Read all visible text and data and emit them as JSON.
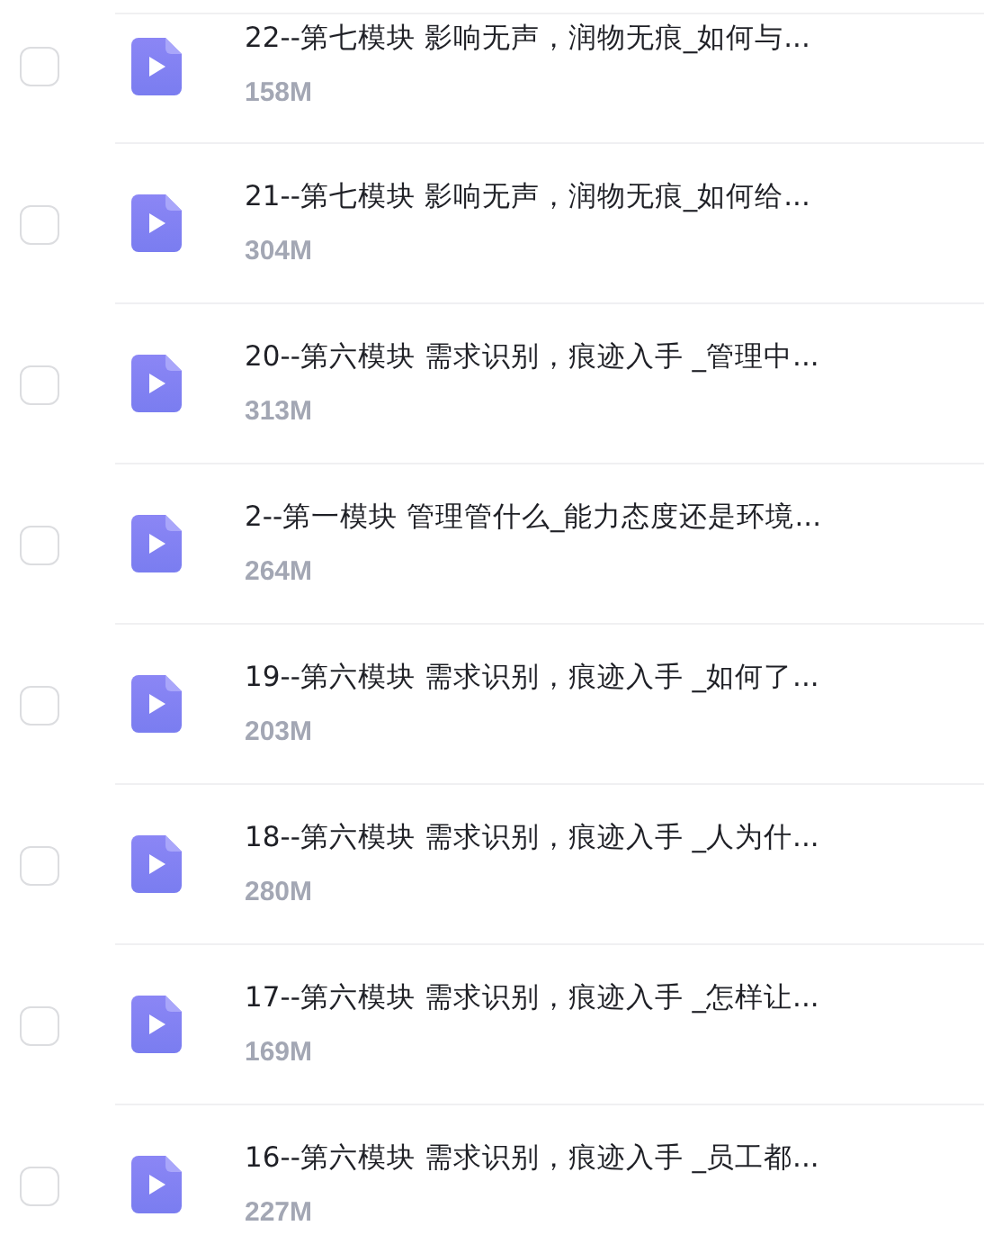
{
  "files": [
    {
      "title": "22--第七模块 影响无声，润物无痕_如何与...",
      "size": "158M",
      "checked": false
    },
    {
      "title": "21--第七模块 影响无声，润物无痕_如何给...",
      "size": "304M",
      "checked": false
    },
    {
      "title": "20--第六模块 需求识别，痕迹入手 _管理中...",
      "size": "313M",
      "checked": false
    },
    {
      "title": "2--第一模块 管理管什么_能力态度还是环境...",
      "size": "264M",
      "checked": false
    },
    {
      "title": "19--第六模块 需求识别，痕迹入手 _如何了...",
      "size": "203M",
      "checked": false
    },
    {
      "title": "18--第六模块 需求识别，痕迹入手 _人为什...",
      "size": "280M",
      "checked": false
    },
    {
      "title": "17--第六模块 需求识别，痕迹入手 _怎样让...",
      "size": "169M",
      "checked": false
    },
    {
      "title": "16--第六模块 需求识别，痕迹入手 _员工都...",
      "size": "227M",
      "checked": false
    }
  ]
}
